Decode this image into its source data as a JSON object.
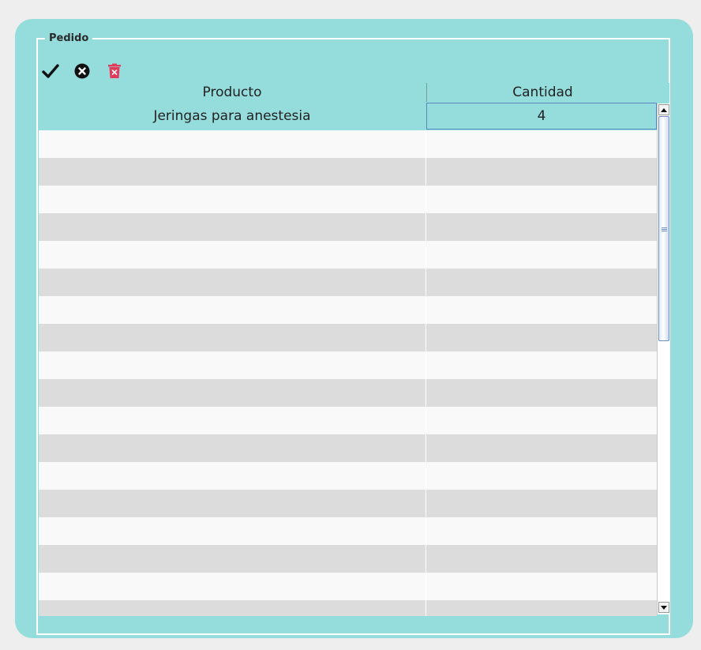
{
  "panel": {
    "legend": "Pedido"
  },
  "toolbar": {
    "accept_icon": "checkmark-icon",
    "cancel_icon": "circle-x-icon",
    "delete_icon": "trash-icon",
    "colors": {
      "accent": "#95dcdc",
      "delete": "#e23b5a"
    }
  },
  "table": {
    "columns": [
      "Producto",
      "Cantidad"
    ],
    "rows": [
      {
        "producto": "Jeringas para anestesia",
        "cantidad": "4"
      }
    ],
    "empty_rows": 18
  }
}
